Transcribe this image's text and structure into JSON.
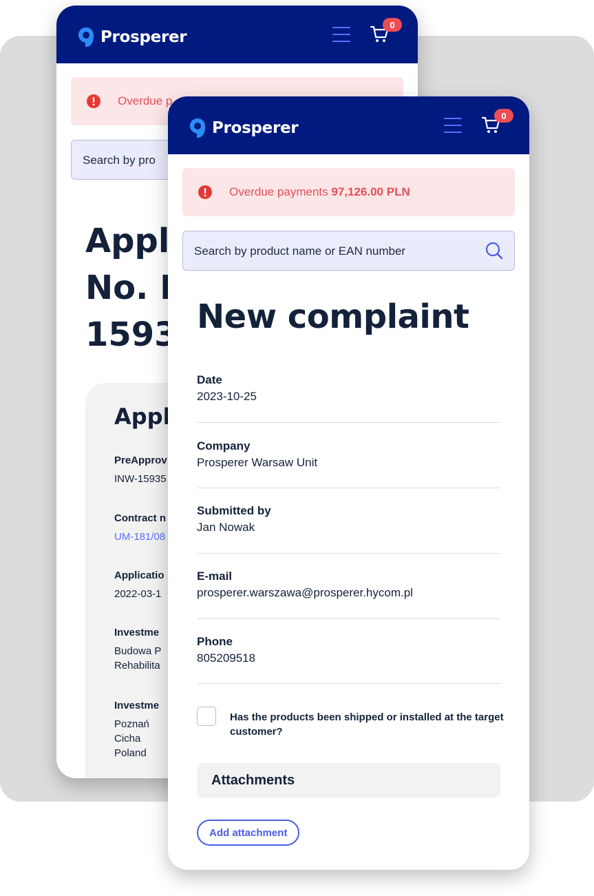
{
  "brand": {
    "name": "Prosperer"
  },
  "cart": {
    "count": "0"
  },
  "alert": {
    "label": "Overdue payments",
    "amount": "97,126.00 PLN"
  },
  "back_screen": {
    "alert_label": "Overdue p",
    "search_placeholder": "Search by pro",
    "title_lines": [
      "Appli",
      "No. IN",
      "15935"
    ],
    "card_title": "Appli",
    "fields": [
      {
        "label": "PreApprov",
        "value": "INW-15935"
      },
      {
        "label": "Contract n",
        "value": "UM-181/08"
      },
      {
        "label": "Applicatio",
        "value": "2022-03-1"
      },
      {
        "label": "Investme",
        "value_lines": [
          "Budowa P",
          "Rehabilita"
        ]
      },
      {
        "label": "Investme",
        "value_lines": [
          "Poznań",
          "Cicha",
          "Poland"
        ]
      }
    ]
  },
  "search": {
    "placeholder": "Search by product name or EAN number"
  },
  "page": {
    "title": "New complaint"
  },
  "fields": {
    "date": {
      "label": "Date",
      "value": "2023-10-25"
    },
    "company": {
      "label": "Company",
      "value": "Prosperer Warsaw Unit"
    },
    "submitted_by": {
      "label": "Submitted by",
      "value": "Jan Nowak"
    },
    "email": {
      "label": "E-mail",
      "value": "prosperer.warszawa@prosperer.hycom.pl"
    },
    "phone": {
      "label": "Phone",
      "value": "805209518"
    }
  },
  "shipped_checkbox": {
    "label": "Has the products been shipped or installed at the target customer?",
    "checked": false
  },
  "attachments": {
    "title": "Attachments",
    "add_label": "Add attachment"
  },
  "colors": {
    "header": "#001a80",
    "accent": "#5a6fff",
    "alert_bg": "#fde6e7",
    "alert_text": "#e55058",
    "badge": "#ec4e55"
  }
}
